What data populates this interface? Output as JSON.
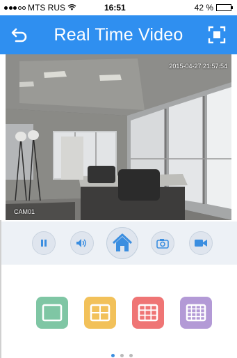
{
  "status_bar": {
    "carrier": "MTS RUS",
    "time": "16:51",
    "battery_text": "42 %",
    "battery_level": 0.42
  },
  "header": {
    "title": "Real Time Video",
    "back_icon": "back-arrow-icon",
    "fullscreen_icon": "fullscreen-icon"
  },
  "video": {
    "timestamp": "2015-04-27 21:57:54",
    "camera_label": "CAM01"
  },
  "controls": [
    {
      "name": "pause",
      "icon": "pause-icon"
    },
    {
      "name": "audio",
      "icon": "speaker-icon"
    },
    {
      "name": "home",
      "icon": "home-icon"
    },
    {
      "name": "snapshot",
      "icon": "camera-icon"
    },
    {
      "name": "record",
      "icon": "video-camera-icon"
    }
  ],
  "layouts": [
    {
      "name": "single",
      "icon": "layout-1-icon",
      "color": "#7fc6a4"
    },
    {
      "name": "quad",
      "icon": "layout-4-icon",
      "color": "#f2c15a"
    },
    {
      "name": "nine",
      "icon": "layout-9-icon",
      "color": "#ef7575"
    },
    {
      "name": "sixteen",
      "icon": "layout-16-icon",
      "color": "#b39ad6"
    }
  ],
  "pager": {
    "pages": 3,
    "current": 1
  },
  "colors": {
    "header_bg": "#2f8ff0",
    "accent": "#3b8ee0",
    "controls_bg": "#edf1f6"
  }
}
